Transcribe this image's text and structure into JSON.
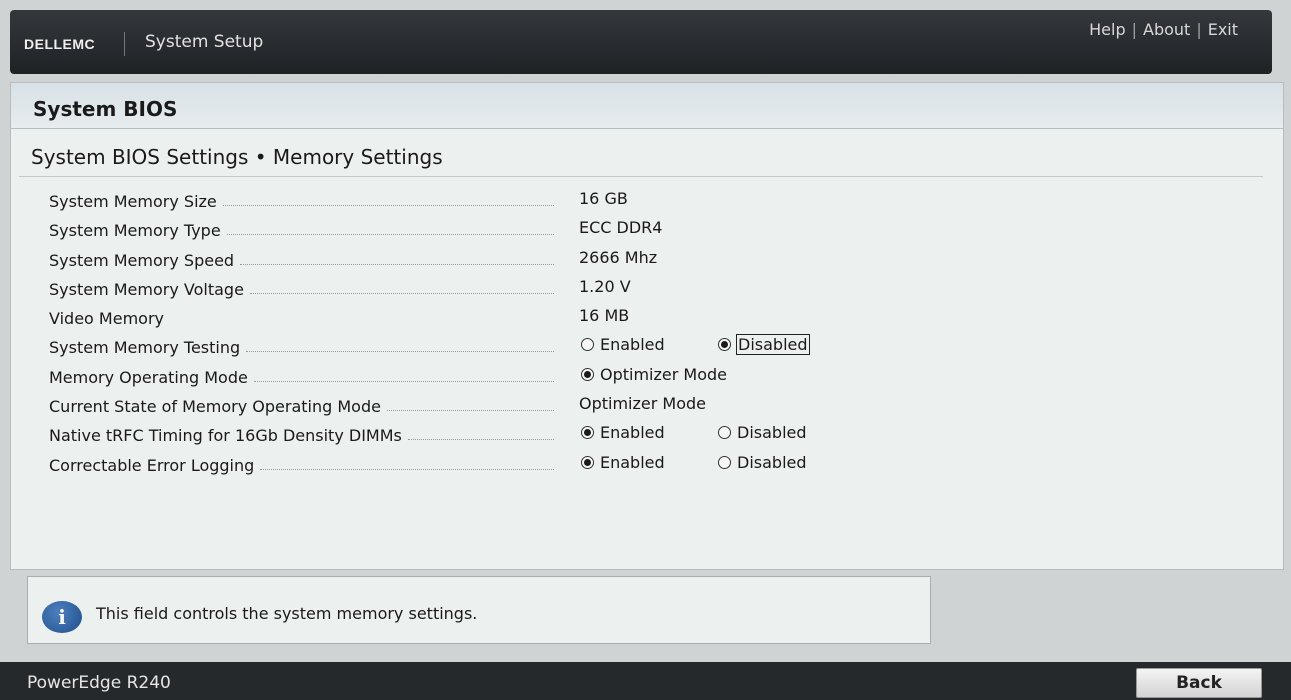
{
  "header": {
    "brand": "DELLEMC",
    "title": "System Setup",
    "links": {
      "help": "Help",
      "about": "About",
      "exit": "Exit"
    }
  },
  "panel": {
    "title": "System BIOS",
    "breadcrumb": "System BIOS Settings • Memory Settings"
  },
  "settings": {
    "memory_size": {
      "label": "System Memory Size",
      "value": "16 GB"
    },
    "memory_type": {
      "label": "System Memory Type",
      "value": "ECC DDR4"
    },
    "memory_speed": {
      "label": "System Memory Speed",
      "value": "2666 Mhz"
    },
    "memory_voltage": {
      "label": "System Memory Voltage",
      "value": "1.20 V"
    },
    "video_memory": {
      "label": "Video Memory",
      "value": "16 MB"
    },
    "memory_testing": {
      "label": "System Memory Testing",
      "opt1": "Enabled",
      "opt2": "Disabled",
      "selected": "Disabled"
    },
    "operating_mode": {
      "label": "Memory Operating Mode",
      "opt1": "Optimizer Mode",
      "selected": "Optimizer Mode"
    },
    "current_state": {
      "label": "Current State of Memory Operating Mode",
      "value": "Optimizer Mode"
    },
    "native_trfc": {
      "label": "Native tRFC Timing for 16Gb Density DIMMs",
      "opt1": "Enabled",
      "opt2": "Disabled",
      "selected": "Enabled"
    },
    "error_logging": {
      "label": "Correctable Error Logging",
      "opt1": "Enabled",
      "opt2": "Disabled",
      "selected": "Enabled"
    }
  },
  "help": {
    "icon": "info-icon",
    "text": "This field controls the system memory settings."
  },
  "footer": {
    "model": "PowerEdge R240",
    "back_label": "Back"
  }
}
